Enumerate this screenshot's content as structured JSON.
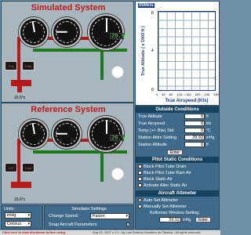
{
  "simulated": {
    "title": "Simulated System",
    "airspeed_display": "0",
    "altimeter_display": "29.92",
    "temp_label": "15.6°c",
    "alt_small": "0 ft",
    "spd_small": "0 kts"
  },
  "reference": {
    "title": "Reference System",
    "airspeed_display": "0",
    "altimeter_display": "29.92",
    "temp_label": "15.6°c",
    "alt_small": "0 ft",
    "spd_small": "0 kts"
  },
  "graph": {
    "corner_label": "000kts",
    "ylabel": "True Altitude ( x 1000 ft )",
    "xlabel": "True Airspeed (Kts)",
    "yticks": [
      "8",
      "4",
      "0"
    ],
    "xticks": [
      "0",
      "40",
      "80",
      "120",
      "160",
      "200",
      "240",
      "280"
    ]
  },
  "outside": {
    "header": "Outside Conditions",
    "rows": [
      {
        "label": "True Altitude",
        "value": "0",
        "unit": "ft"
      },
      {
        "label": "True Airspeed",
        "value": "0",
        "unit": "kts"
      },
      {
        "label": "Temp (+/- Blw) Std",
        "value": "0",
        "unit": "°C"
      },
      {
        "label": "Station Altim Setting",
        "value": "29.92",
        "unit": "inHg"
      },
      {
        "label": "Station Altitude",
        "value": "0",
        "unit": "ft"
      }
    ],
    "enter_label": "Enter"
  },
  "pitot": {
    "header": "Pitot Static Conditions",
    "items": [
      {
        "label": "Block Pitot Tube Drain",
        "checked": false
      },
      {
        "label": "Block Pitot Tube Ram Air",
        "checked": false
      },
      {
        "label": "Block Static Air",
        "checked": false
      },
      {
        "label": "Activate Alter Static Air",
        "checked": false
      }
    ]
  },
  "altimeter": {
    "header": "Aircraft Altimeter",
    "auto_label": "Auto Set Altimeter",
    "manual_label": "Manually Set Altimeter",
    "auto_selected": true,
    "kollsman_label": "Kollsman Window Setting:",
    "kollsman_value": "29.92",
    "kollsman_unit": "inHg",
    "enter_label": "Enter"
  },
  "units": {
    "label": "Units:",
    "pressure": "inHg",
    "temperature": "Celsius"
  },
  "simsettings": {
    "header": "Simulator Settings",
    "speed_label": "Change Speed:",
    "speed_value": "Faster",
    "snap_label": "Snap Aircraft Parameters",
    "snap_checked": true
  },
  "footer": {
    "left": "Click here to view disclaimer before using.",
    "right": "Aug 02, 2007 v 1.1 - by Luis Roberto Monteiro de Oliveira - All rights reserved"
  },
  "colors": {
    "panel_bg": "#a8b6be",
    "title_red": "#c0191b",
    "header_blue": "#16445f",
    "pipe_red": "#b51a1a",
    "pipe_green": "#1c7a1c"
  }
}
